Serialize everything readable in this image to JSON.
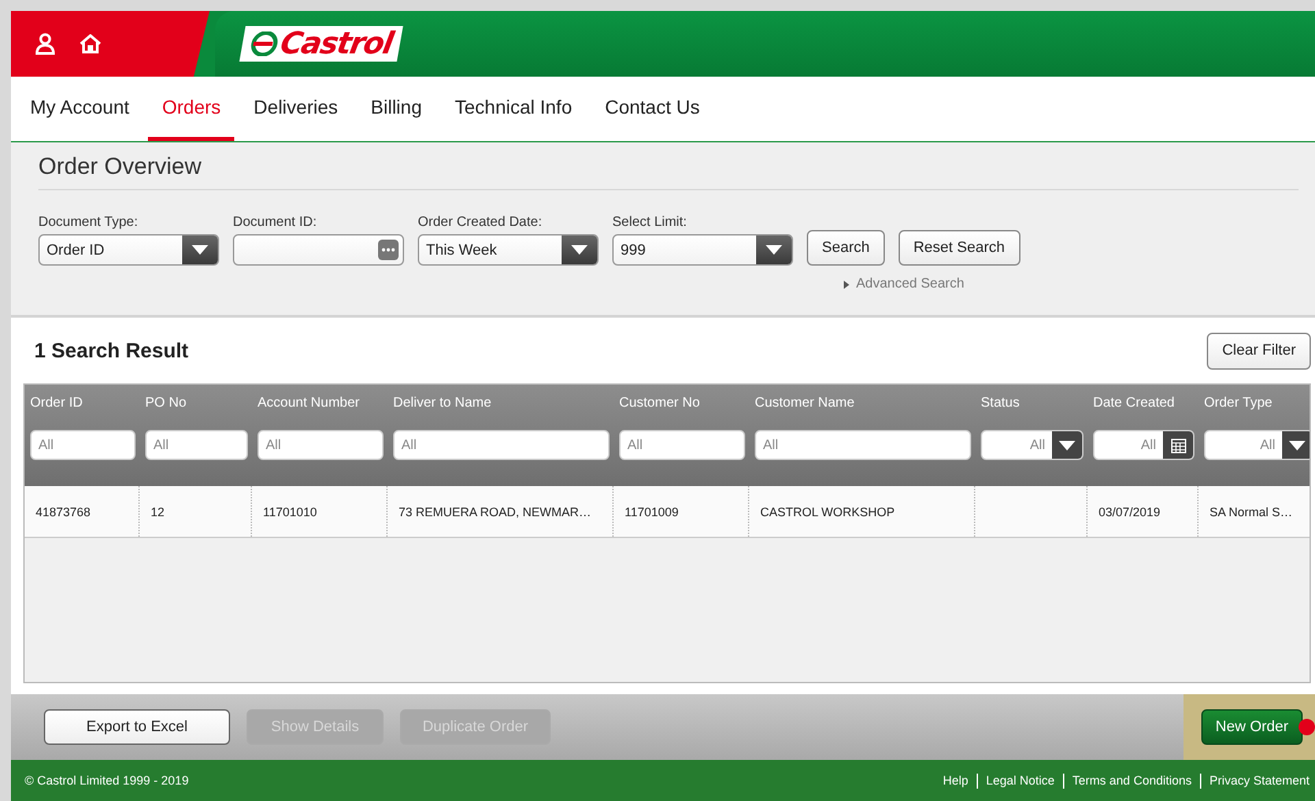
{
  "header": {
    "logo": "Castrol"
  },
  "nav": [
    {
      "label": "My Account",
      "selected": false
    },
    {
      "label": "Orders",
      "selected": true
    },
    {
      "label": "Deliveries",
      "selected": false
    },
    {
      "label": "Billing",
      "selected": false
    },
    {
      "label": "Technical Info",
      "selected": false
    },
    {
      "label": "Contact Us",
      "selected": false
    }
  ],
  "overview": {
    "title": "Order Overview",
    "fields": [
      {
        "label": "Document Type:",
        "kind": "select",
        "value": "Order ID"
      },
      {
        "label": "Document ID:",
        "kind": "text"
      },
      {
        "label": "Order Created Date:",
        "kind": "select",
        "value": "This Week"
      },
      {
        "label": "Select Limit:",
        "kind": "select",
        "value": "999"
      }
    ],
    "buttons": [
      "Search",
      "Reset Search"
    ],
    "advanced": "Advanced Search"
  },
  "results": {
    "title": "1 Search Result",
    "clear_button": "Clear Filter",
    "columns": [
      {
        "label": "Order ID",
        "kind": "text",
        "filter": "All"
      },
      {
        "label": "PO No",
        "kind": "text",
        "filter": "All"
      },
      {
        "label": "Account Number",
        "kind": "text",
        "filter": "All"
      },
      {
        "label": "Deliver to Name",
        "kind": "text",
        "filter": "All"
      },
      {
        "label": "Customer No",
        "kind": "text",
        "filter": "All"
      },
      {
        "label": "Customer Name",
        "kind": "text",
        "filter": "All"
      },
      {
        "label": "Status",
        "kind": "select",
        "filter": "All"
      },
      {
        "label": "Date Created",
        "kind": "date",
        "filter": "All"
      },
      {
        "label": "Order Type",
        "kind": "select",
        "filter": "All"
      }
    ],
    "rows": [
      [
        "41873768",
        "12",
        "11701010",
        "73 REMUERA ROAD, NEWMAR…",
        "11701009",
        "CASTROL WORKSHOP",
        "",
        "03/07/2019",
        "SA Normal S…"
      ]
    ]
  },
  "actions": [
    {
      "label": "Export to Excel",
      "disabled": false
    },
    {
      "label": "Show Details",
      "disabled": true
    },
    {
      "label": "Duplicate Order",
      "disabled": true
    }
  ],
  "primary_action": "New Order",
  "footer": {
    "copyright": "© Castrol Limited 1999 - 2019",
    "links": [
      "Help",
      "Legal Notice",
      "Terms and Conditions",
      "Privacy Statement"
    ]
  }
}
